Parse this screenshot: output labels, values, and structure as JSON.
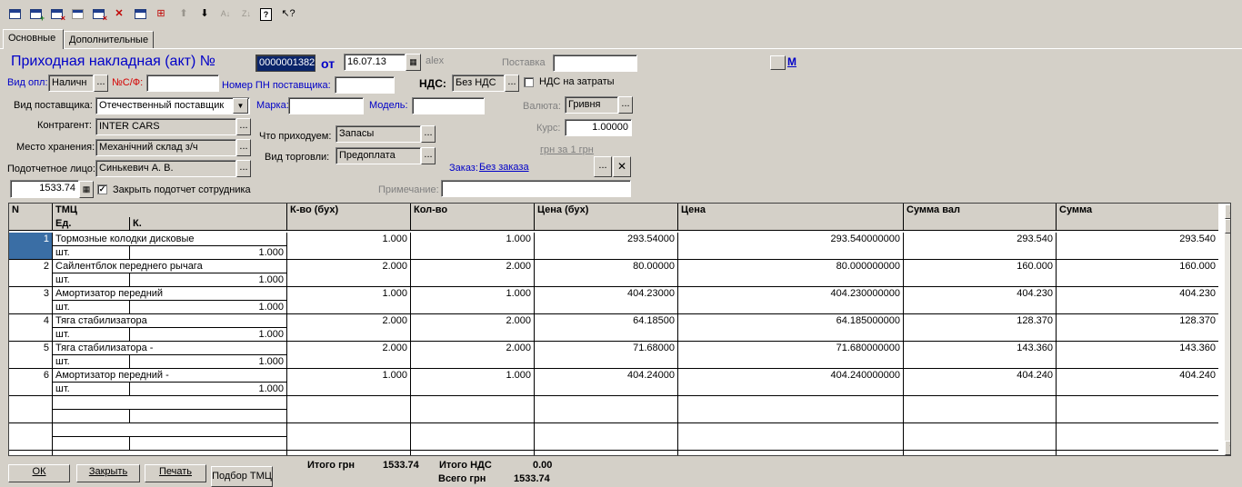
{
  "toolbar": {
    "icons": [
      "new-doc-icon",
      "add-row-icon",
      "delete-row-icon",
      "copy-row-icon",
      "delete-doc-icon",
      "remove-item-icon",
      "edit-doc-icon",
      "insert-row-icon",
      "move-up-icon",
      "move-down-icon",
      "sort-asc-icon",
      "sort-desc-icon",
      "help-icon",
      "whats-this-icon"
    ]
  },
  "tabs": [
    {
      "label": "Основные"
    },
    {
      "label": "Дополнительные"
    }
  ],
  "header": {
    "title": "Приходная накладная (акт) №",
    "doc_number": "0000001382",
    "from_label": "от",
    "date": "16.07.13",
    "user": "alex",
    "supply_label": "Поставка",
    "supply_value": "",
    "m_label": "М"
  },
  "form": {
    "payment_label": "Вид опл:",
    "payment_value": "Наличн",
    "invoice_label": "№С/Ф:",
    "invoice_value": "",
    "supplier_pn_label": "Номер ПН поставщика:",
    "supplier_pn_value": "",
    "vat_label": "НДС:",
    "vat_value": "Без НДС",
    "vat_expense_label": "НДС на затраты",
    "supplier_type_label": "Вид поставщика:",
    "supplier_type_value": "Отечественный поставщик",
    "brand_label": "Марка:",
    "brand_value": "",
    "model_label": "Модель:",
    "model_value": "",
    "currency_label": "Валюта:",
    "currency_value": "Гривня",
    "counterparty_label": "Контрагент:",
    "counterparty_value": "INTER CARS",
    "rate_label": "Курс:",
    "rate_value": "1.00000",
    "storage_label": "Место хранения:",
    "storage_value": "Механічний склад з/ч",
    "what_label": "Что приходуем:",
    "what_value": "Запасы",
    "uah_per_label": "грн за 1 грн",
    "accountable_label": "Подотчетное лицо:",
    "accountable_value": "Синькевич А. В.",
    "trade_type_label": "Вид торговли:",
    "trade_type_value": "Предоплата",
    "order_label": "Заказ:",
    "order_value": "Без заказа",
    "amount_value": "1533.74",
    "close_report_label": "Закрыть подотчет сотрудника",
    "note_label": "Примечание:",
    "note_value": ""
  },
  "grid": {
    "columns": {
      "n": "N",
      "tmc": "ТМЦ",
      "unit": "Ед.",
      "k": "К.",
      "qty_acc": "К-во (бух)",
      "qty": "Кол-во",
      "price_acc": "Цена (бух)",
      "price": "Цена",
      "sum_cur": "Сумма вал",
      "sum": "Сумма"
    },
    "rows": [
      {
        "n": "1",
        "name": "Тормозные колодки дисковые",
        "unit": "шт.",
        "k": "1.000",
        "qty_acc": "1.000",
        "qty": "1.000",
        "price_acc": "293.54000",
        "price": "293.540000000",
        "sum_cur": "293.540",
        "sum": "293.540"
      },
      {
        "n": "2",
        "name": "Сайлентблок переднего рычага",
        "unit": "шт.",
        "k": "1.000",
        "qty_acc": "2.000",
        "qty": "2.000",
        "price_acc": "80.00000",
        "price": "80.000000000",
        "sum_cur": "160.000",
        "sum": "160.000"
      },
      {
        "n": "3",
        "name": "Амортизатор передний",
        "unit": "шт.",
        "k": "1.000",
        "qty_acc": "1.000",
        "qty": "1.000",
        "price_acc": "404.23000",
        "price": "404.230000000",
        "sum_cur": "404.230",
        "sum": "404.230"
      },
      {
        "n": "4",
        "name": "Тяга стабилизатора",
        "unit": "шт.",
        "k": "1.000",
        "qty_acc": "2.000",
        "qty": "2.000",
        "price_acc": "64.18500",
        "price": "64.185000000",
        "sum_cur": "128.370",
        "sum": "128.370"
      },
      {
        "n": "5",
        "name": "Тяга стабилизатора -",
        "unit": "шт.",
        "k": "1.000",
        "qty_acc": "2.000",
        "qty": "2.000",
        "price_acc": "71.68000",
        "price": "71.680000000",
        "sum_cur": "143.360",
        "sum": "143.360"
      },
      {
        "n": "6",
        "name": "Амортизатор передний -",
        "unit": "шт.",
        "k": "1.000",
        "qty_acc": "1.000",
        "qty": "1.000",
        "price_acc": "404.24000",
        "price": "404.240000000",
        "sum_cur": "404.240",
        "sum": "404.240"
      }
    ]
  },
  "buttons": {
    "ok": "ОК",
    "close": "Закрыть",
    "print": "Печать",
    "select_tmc": "Подбор ТМЦ"
  },
  "totals": {
    "total_uah_label": "Итого грн",
    "total_uah": "1533.74",
    "total_vat_label": "Итого НДС",
    "total_vat": "0.00",
    "grand_total_label": "Всего грн",
    "grand_total": "1533.74"
  }
}
